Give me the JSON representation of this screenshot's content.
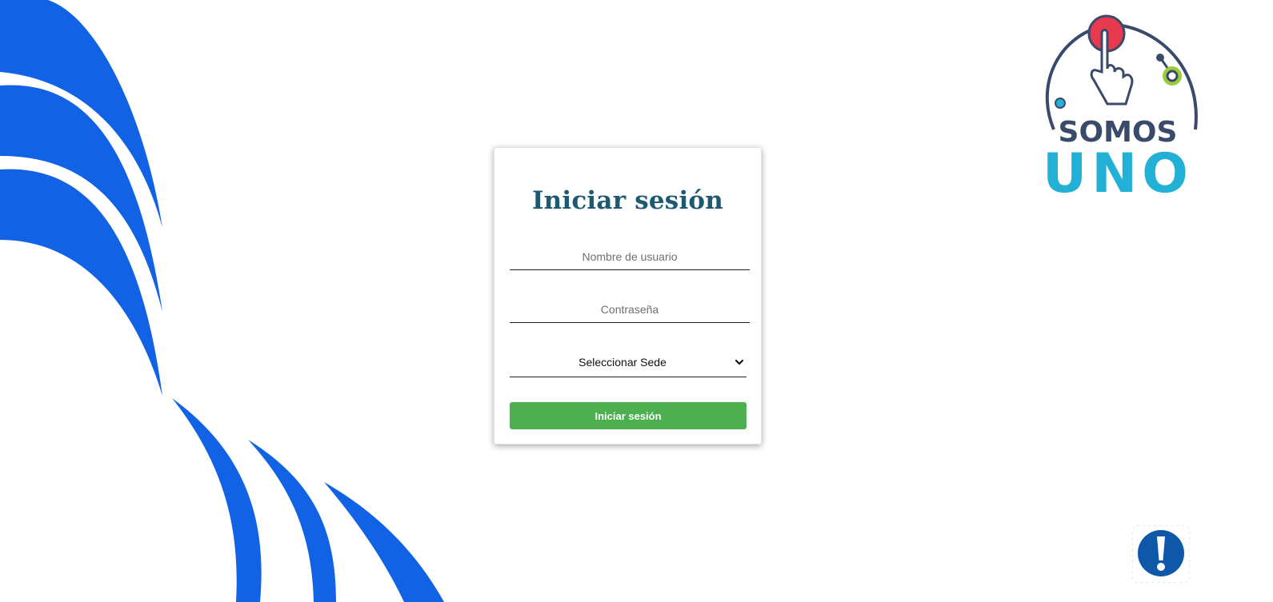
{
  "login": {
    "title": "Iniciar sesión",
    "username_placeholder": "Nombre de usuario",
    "username_value": "",
    "password_placeholder": "Contraseña",
    "password_value": "",
    "sede_selected": "Seleccionar Sede",
    "submit_label": "Iniciar sesión"
  },
  "logo": {
    "line1": "SOMOS",
    "line2": "UNO"
  },
  "icons": {
    "help": "exclamation-icon",
    "select": "chevron-down-icon"
  },
  "colors": {
    "brand_blue": "#1262e6",
    "title_teal": "#1d5a72",
    "submit_green": "#4caf50",
    "help_blue": "#0d58a8",
    "logo_cyan": "#22b0d6",
    "logo_navy": "#3a4a6b",
    "logo_red": "#e8394f",
    "logo_green": "#9ccc3c"
  }
}
